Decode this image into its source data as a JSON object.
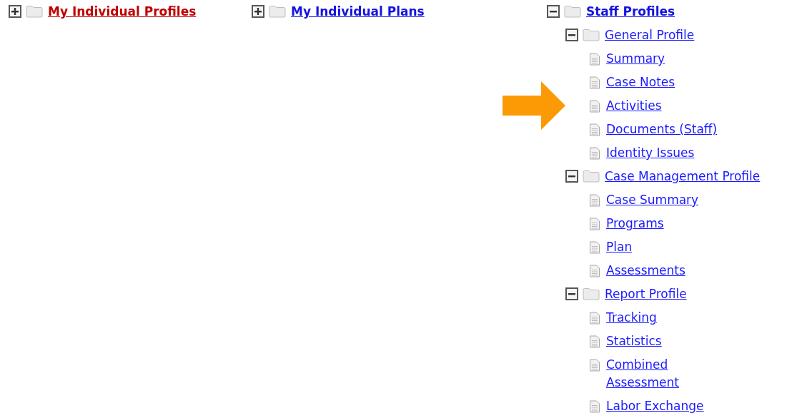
{
  "trees": [
    {
      "label": "My Individual Profiles",
      "selected": true,
      "expanded": false
    },
    {
      "label": "My Individual Plans",
      "selected": false,
      "expanded": false
    },
    {
      "label": "Staff Profiles",
      "selected": false,
      "expanded": true,
      "children": [
        {
          "label": "General Profile",
          "expanded": true,
          "children": [
            {
              "label": "Summary",
              "pointed": false
            },
            {
              "label": "Case Notes",
              "pointed": false
            },
            {
              "label": "Activities",
              "pointed": true
            },
            {
              "label": "Documents (Staff)",
              "pointed": false
            },
            {
              "label": "Identity Issues",
              "pointed": false
            }
          ]
        },
        {
          "label": "Case Management Profile",
          "expanded": true,
          "children": [
            {
              "label": "Case Summary",
              "pointed": false
            },
            {
              "label": "Programs",
              "pointed": false
            },
            {
              "label": "Plan",
              "pointed": false
            },
            {
              "label": "Assessments",
              "pointed": false
            }
          ]
        },
        {
          "label": "Report Profile",
          "expanded": true,
          "children": [
            {
              "label": "Tracking",
              "pointed": false
            },
            {
              "label": "Statistics",
              "pointed": false
            },
            {
              "label": "Combined Assessment",
              "pointed": false
            },
            {
              "label": "Labor Exchange",
              "pointed": false
            }
          ]
        }
      ]
    }
  ]
}
